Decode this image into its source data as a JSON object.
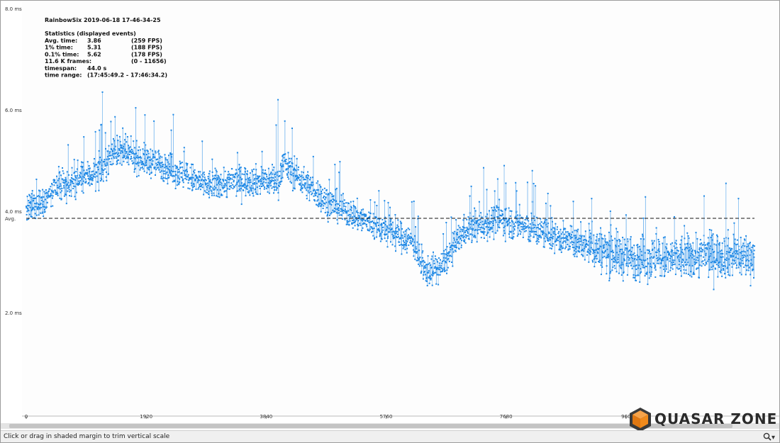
{
  "status_bar": {
    "hint": "Click or drag in shaded margin to trim vertical scale",
    "zoom_icon": "magnifier-icon",
    "zoom_arrow": "▾"
  },
  "logo": {
    "text": "QUASAR ZONE",
    "icon": "cube-icon",
    "accent": "#f08a1c"
  },
  "chart_data": {
    "type": "scatter",
    "title": "RainbowSix 2019-06-18 17-46-34-25",
    "stats_header": "Statistics (displayed events)",
    "stats": [
      {
        "label": "Avg. time:",
        "value": "3.86",
        "extra": "(259 FPS)"
      },
      {
        "label": "1% time:",
        "value": "5.31",
        "extra": "(188 FPS)"
      },
      {
        "label": "0.1% time:",
        "value": "5.62",
        "extra": "(178 FPS)"
      },
      {
        "label": "11.6 K frames:",
        "value": "",
        "extra": "(0 - 11656)"
      },
      {
        "label": "timespan:",
        "value": "44.0 s",
        "extra": ""
      },
      {
        "label": "time range:",
        "value": "(17:45:49.2 - 17:46:34.2)",
        "extra": ""
      }
    ],
    "y_ticks": [
      {
        "value": 8.0,
        "label": "8.0 ms"
      },
      {
        "value": 6.0,
        "label": "6.0 ms"
      },
      {
        "value": 4.0,
        "label": "4.0 ms"
      },
      {
        "value": 2.0,
        "label": "2.0 ms"
      }
    ],
    "x_ticks": [
      {
        "value": 0,
        "label": "0"
      },
      {
        "value": 1920,
        "label": "1920"
      },
      {
        "value": 3840,
        "label": "3840"
      },
      {
        "value": 5760,
        "label": "5760"
      },
      {
        "value": 7680,
        "label": "7680"
      },
      {
        "value": 9600,
        "label": "960"
      }
    ],
    "avg_line": {
      "value": 3.86,
      "label": "Avg."
    },
    "xlim": [
      0,
      11656
    ],
    "ylim": [
      0,
      8.0
    ],
    "color": "#1e88e5",
    "series": [
      {
        "trend_x": [
          0,
          600,
          1200,
          1400,
          2200,
          2900,
          3400,
          4050,
          4100,
          4800,
          5600,
          6200,
          6350,
          6650,
          7000,
          7600,
          8200,
          9000,
          9600,
          10300,
          11000,
          11656
        ],
        "trend_y": [
          4.0,
          4.5,
          4.8,
          5.2,
          4.9,
          4.5,
          4.6,
          4.6,
          4.95,
          4.2,
          3.7,
          3.4,
          2.8,
          2.9,
          3.6,
          3.85,
          3.6,
          3.3,
          3.1,
          3.05,
          3.15,
          3.1
        ],
        "spikes": [
          {
            "x": 1220,
            "y": 6.35
          },
          {
            "x": 1900,
            "y": 5.9
          },
          {
            "x": 4030,
            "y": 6.2
          },
          {
            "x": 4000,
            "y": 5.7
          },
          {
            "x": 7100,
            "y": 4.3
          },
          {
            "x": 7650,
            "y": 4.9
          },
          {
            "x": 7850,
            "y": 4.4
          },
          {
            "x": 8100,
            "y": 4.8
          },
          {
            "x": 8150,
            "y": 4.5
          },
          {
            "x": 8350,
            "y": 4.35
          },
          {
            "x": 9050,
            "y": 4.25
          },
          {
            "x": 10850,
            "y": 4.3
          },
          {
            "x": 11200,
            "y": 4.55
          },
          {
            "x": 11400,
            "y": 4.25
          }
        ]
      }
    ]
  }
}
